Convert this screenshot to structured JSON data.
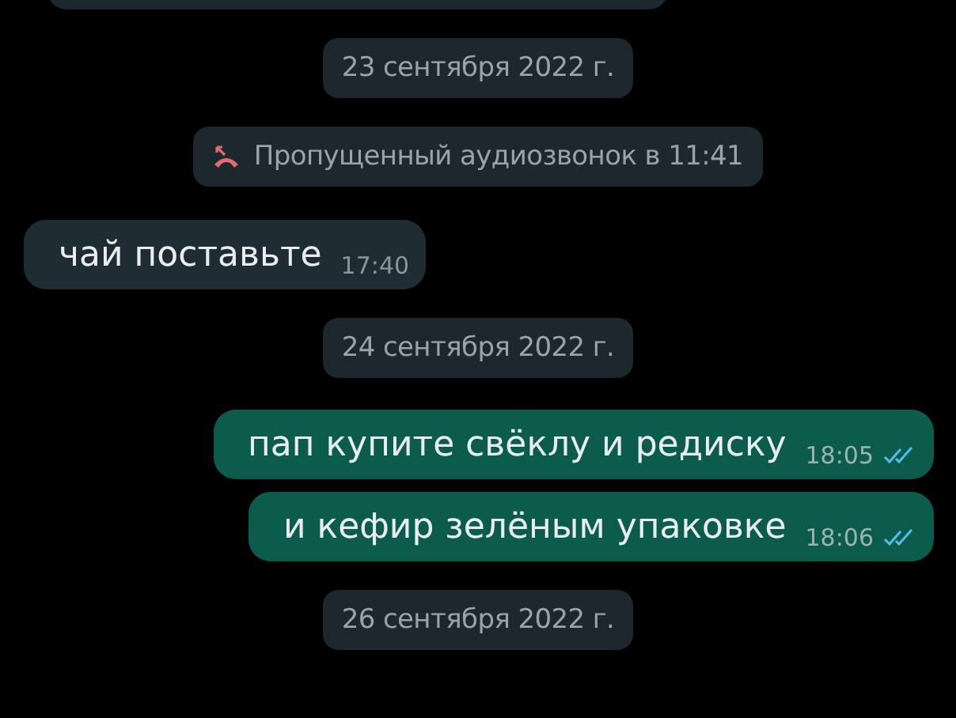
{
  "chat": [
    {
      "kind": "partial"
    },
    {
      "kind": "date",
      "text": "23 сентября 2022 г."
    },
    {
      "kind": "missed_call",
      "text": "Пропущенный аудиозвонок в 11:41"
    },
    {
      "kind": "incoming",
      "text": "чай поставьте",
      "time": "17:40"
    },
    {
      "kind": "date",
      "text": "24 сентября 2022 г."
    },
    {
      "kind": "outgoing",
      "text": "пап купите свёклу и редиску",
      "time": "18:05",
      "read": true
    },
    {
      "kind": "outgoing",
      "text": "и кефир зелёным упаковке",
      "time": "18:06",
      "read": true
    },
    {
      "kind": "date",
      "text": "26 сентября 2022 г."
    }
  ]
}
